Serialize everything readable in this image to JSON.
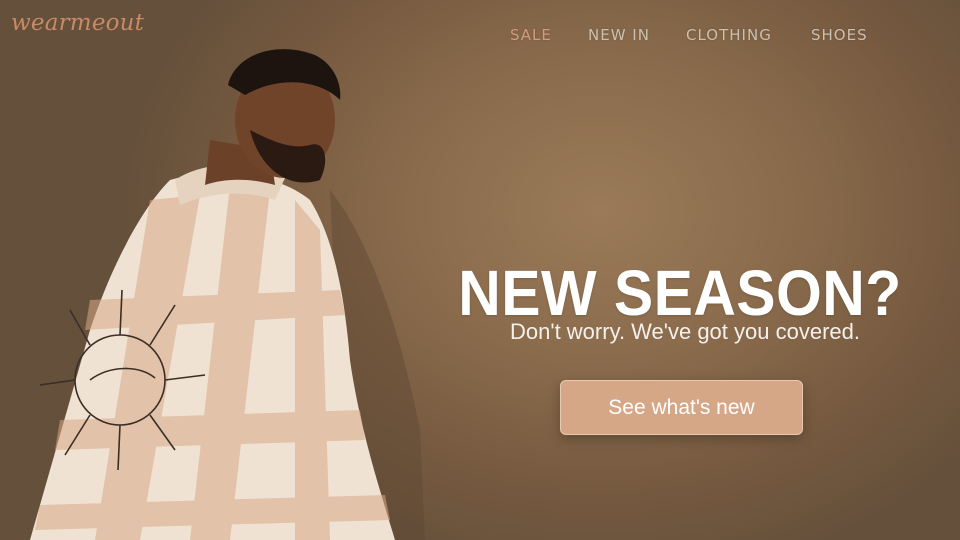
{
  "brand": {
    "logo_text": "wearmeout"
  },
  "nav": {
    "items": [
      {
        "label": "SALE",
        "active": true
      },
      {
        "label": "NEW IN",
        "active": false
      },
      {
        "label": "CLOTHING",
        "active": false
      },
      {
        "label": "SHOES",
        "active": false
      }
    ]
  },
  "hero": {
    "headline": "NEW SEASON?",
    "subheadline": "Don't worry. We've got you covered.",
    "cta_label": "See what's new",
    "image_subject": "man-in-plaid-shirt-photo"
  },
  "colors": {
    "background": "#8a6b4c",
    "logo": "#c88a66",
    "nav_active": "#d49a7f",
    "nav_text": "#cbbfae",
    "cta_background": "#d5a787",
    "headline": "#ffffff"
  }
}
